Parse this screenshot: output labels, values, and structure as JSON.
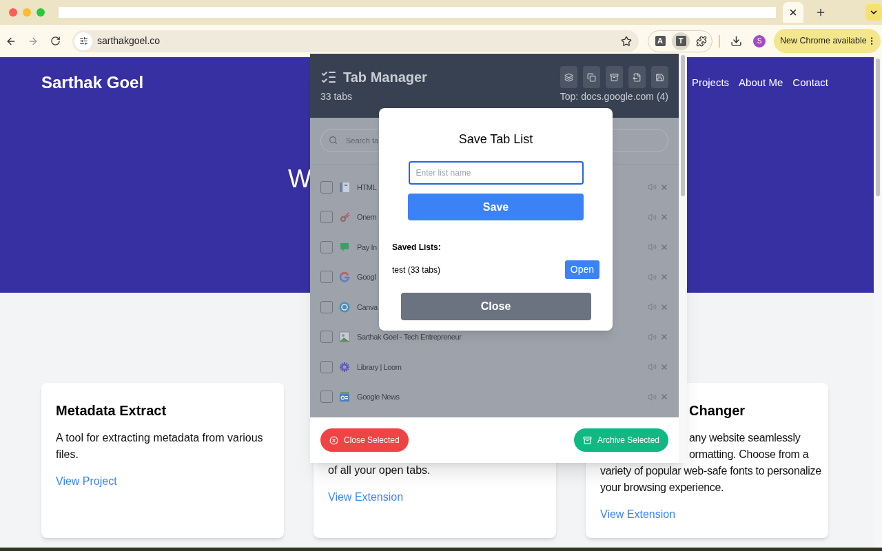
{
  "browser": {
    "address": "sarthakgoel.co",
    "extensions": [
      {
        "label": "A",
        "selected": false
      },
      {
        "label": "T",
        "selected": true
      }
    ],
    "profile": "S",
    "update_button": "New Chrome available"
  },
  "page": {
    "site_title": "Sarthak Goel",
    "nav": [
      "Projects",
      "About Me",
      "Contact"
    ],
    "hero_heading": "W",
    "cards": [
      {
        "title": {
          "text": "Metadata Extract",
          "kind": "full"
        },
        "lines": [
          {
            "text": "A tool for extracting metadata from various files.",
            "kind": "full"
          }
        ],
        "link": "View Project"
      },
      {
        "lines": [
          {
            "text": "of all your open tabs.",
            "kind": "full"
          }
        ],
        "link": "View Extension"
      },
      {
        "title": {
          "text": "Changer",
          "kind": "cut"
        },
        "lines": [
          {
            "text": "any website seamlessly",
            "kind": "cut"
          },
          {
            "text": "ormatting. Choose from a",
            "kind": "cut"
          },
          {
            "text": "variety of popular web-safe fonts to personalize",
            "kind": "full"
          },
          {
            "text": "your browsing experience.",
            "kind": "full"
          }
        ],
        "link": "View Extension"
      }
    ]
  },
  "popup": {
    "title": "Tab Manager",
    "tab_count": "33 tabs",
    "top_domain": "Top: docs.google.com (4)",
    "search_placeholder": "Search ta",
    "tabs": [
      {
        "title": "HTML",
        "checked": false
      },
      {
        "title": "Onem",
        "checked": false
      },
      {
        "title": "Pay In",
        "checked": false
      },
      {
        "title": "Googl",
        "checked": false
      },
      {
        "title": "Canva",
        "checked": false
      },
      {
        "title": "Sarthak Goel - Tech Entrepreneur",
        "checked": false
      },
      {
        "title": "Library | Loom",
        "checked": false
      },
      {
        "title": "Google News",
        "checked": false
      }
    ],
    "close_selected": "Close Selected",
    "archive_selected": "Archive Selected"
  },
  "modal": {
    "title": "Save Tab List",
    "input_placeholder": "Enter list name",
    "save": "Save",
    "saved_heading": "Saved Lists:",
    "lists": [
      {
        "name": "test (33 tabs)",
        "action": "Open"
      }
    ],
    "close": "Close"
  }
}
